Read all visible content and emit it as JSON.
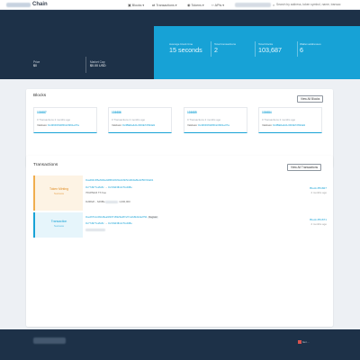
{
  "nav": {
    "brand": "Chain",
    "items": [
      {
        "label": "Blocks",
        "icon": "cube-icon"
      },
      {
        "label": "Transactions",
        "icon": "arrows-icon"
      },
      {
        "label": "Tokens",
        "icon": "coins-icon"
      },
      {
        "label": "APIs",
        "icon": "code-icon"
      }
    ],
    "search_placeholder": "Search by address, token symbol, name, transac"
  },
  "hero": {
    "fields": [
      {
        "label": "Price",
        "value": "$0"
      },
      {
        "label": "Market Cap",
        "value": "$0.00 USD"
      }
    ]
  },
  "stats": [
    {
      "label": "Average block time",
      "value": "15 seconds"
    },
    {
      "label": "Total transactions",
      "value": "2"
    },
    {
      "label": "Total blocks",
      "value": "103,687"
    },
    {
      "label": "Wallet addresses",
      "value": "6"
    }
  ],
  "blocks": {
    "title": "Blocks",
    "view_all": "View All Blocks",
    "tiles": [
      {
        "number": "103687",
        "meta": "0 Transactions   2 months ago",
        "validator_label": "Validator",
        "hash": "0x436F0f0d8D4c3961e07a"
      },
      {
        "number": "103686",
        "meta": "0 Transactions   2 months ago",
        "validator_label": "Validator",
        "hash": "0x3BE0a4d1c0b6E72694a9"
      },
      {
        "number": "103685",
        "meta": "0 Transactions   2 months ago",
        "validator_label": "Validator",
        "hash": "0x436F0f0d8D4c3961e07a"
      },
      {
        "number": "103684",
        "meta": "0 Transactions   2 months ago",
        "validator_label": "Validator",
        "hash": "0x3BE0a4d1c0b6E72694a9"
      }
    ]
  },
  "transactions": {
    "title": "Transactions",
    "view_all": "View All Transactions",
    "rows": [
      {
        "badge_title": "Token Minting",
        "badge_sub": "Success",
        "badge_color": "#f0ad4e",
        "badge_bg": "#fdf3e4",
        "hash": "0xa4b6c3f6e6fd4e0d863c8cf3e0cbb5cd2b0a6fe32567d3a91",
        "from": "0x77d977e2fa5c",
        "to": "0x7d9d3fb4c7bcd08e",
        "extra": "7010f5d24 TX Fee",
        "small": "0x96bdf... 6d9f8e",
        "amount": "1,000,000",
        "block": "Block #51827",
        "ago": "2 months ago"
      },
      {
        "badge_title": "Transaction",
        "badge_sub": "Success",
        "badge_color": "#17a2d6",
        "badge_bg": "#e6f5fb",
        "hash": "0xe26711c2bbd6ea9f23716923a0f7ef7ce6d9d12a2791",
        "pill": "Register",
        "from": "0x77d977e2fa5c",
        "to": "0x7d9d3fb4c7bcd08e",
        "block": "Block #51671",
        "ago": "2 months ago"
      }
    ]
  },
  "footer": {
    "badge_text": "Get ..."
  }
}
